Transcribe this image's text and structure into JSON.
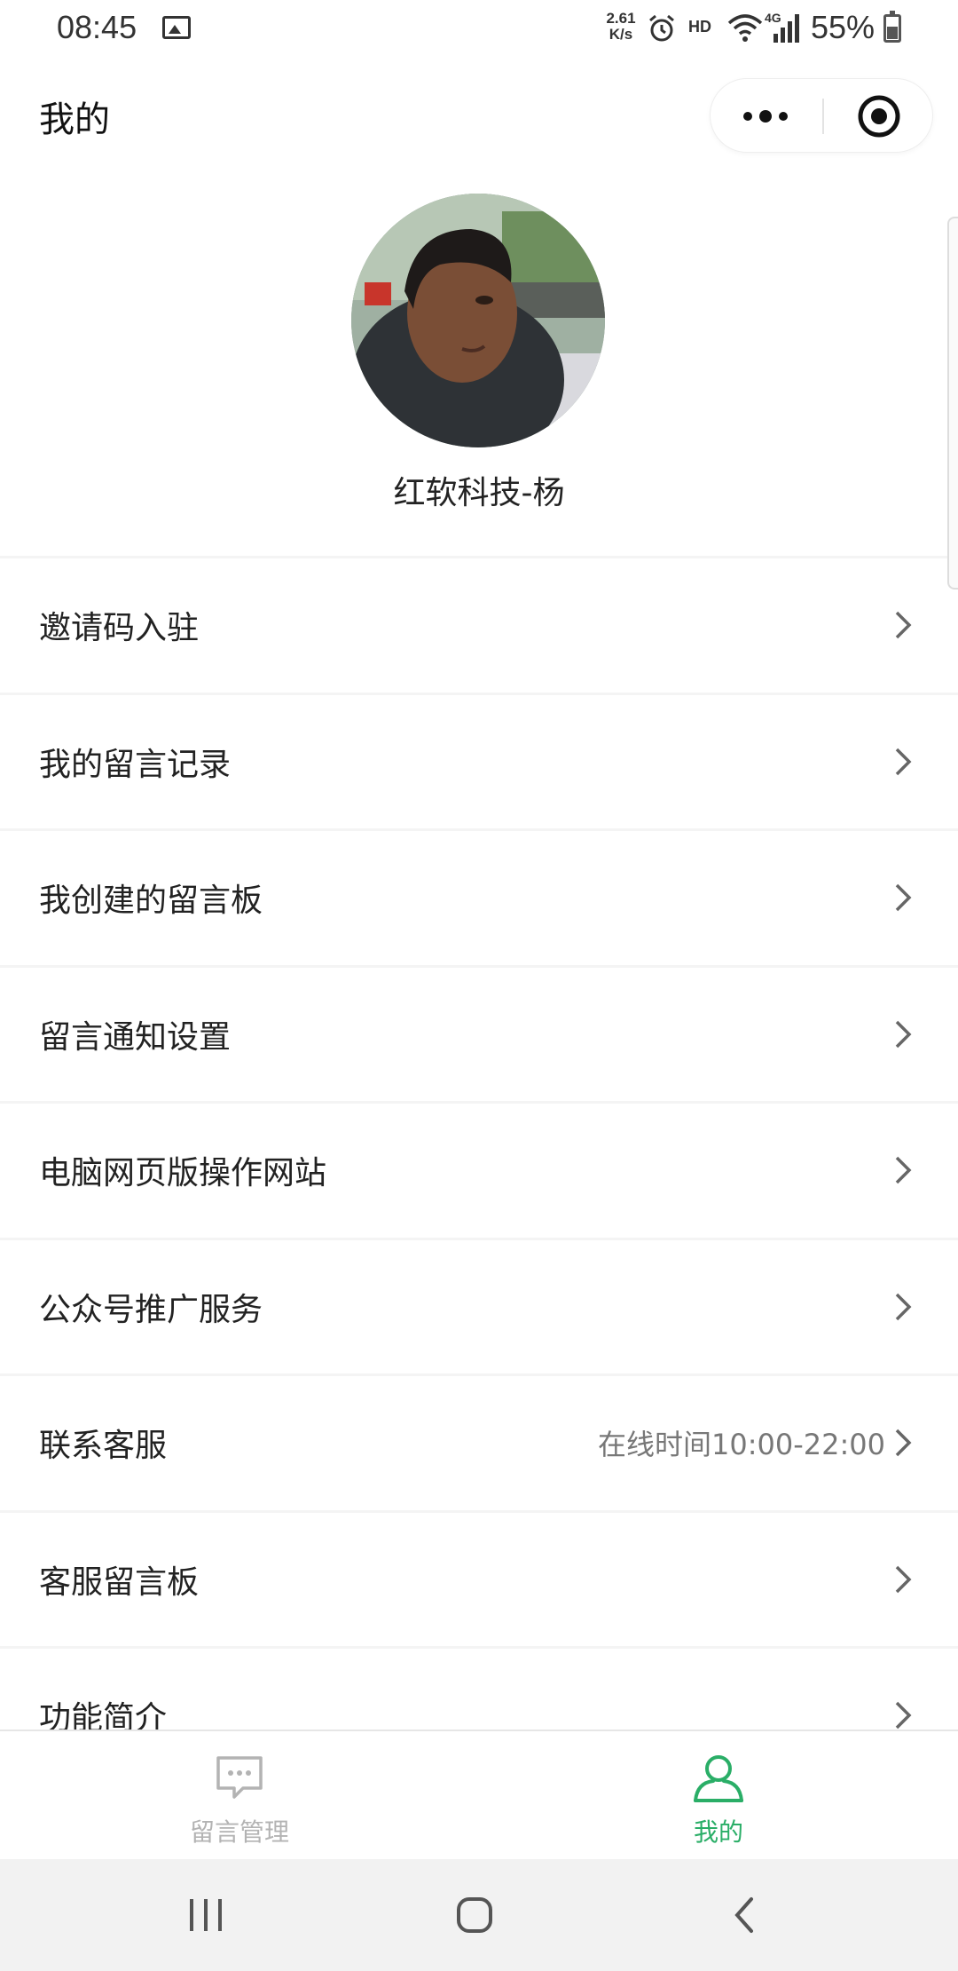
{
  "status_bar": {
    "time": "08:45",
    "net_speed_value": "2.61",
    "net_speed_unit": "K/s",
    "hd": "HD",
    "network": "4G",
    "battery": "55%"
  },
  "nav": {
    "title": "我的"
  },
  "profile": {
    "username": "红软科技-杨"
  },
  "menu": {
    "items": [
      {
        "label": "邀请码入驻",
        "right": ""
      },
      {
        "label": "我的留言记录",
        "right": ""
      },
      {
        "label": "我创建的留言板",
        "right": ""
      },
      {
        "label": "留言通知设置",
        "right": ""
      },
      {
        "label": "电脑网页版操作网站",
        "right": ""
      },
      {
        "label": "公众号推广服务",
        "right": ""
      },
      {
        "label": "联系客服",
        "right": "在线时间10:00-22:00"
      },
      {
        "label": "客服留言板",
        "right": ""
      },
      {
        "label": "功能简介",
        "right": ""
      }
    ]
  },
  "tabs": [
    {
      "label": "留言管理",
      "icon": "message-icon",
      "active": false
    },
    {
      "label": "我的",
      "icon": "person-icon",
      "active": true
    }
  ],
  "colors": {
    "accent": "#2aae67",
    "inactive": "#b3b3b3"
  }
}
